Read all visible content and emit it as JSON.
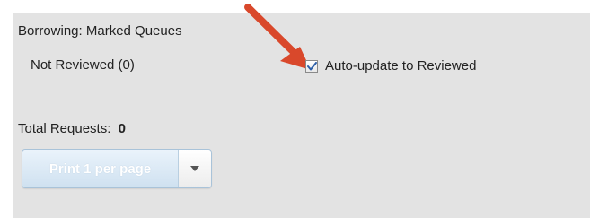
{
  "section": {
    "title": "Borrowing: Marked Queues"
  },
  "queue": {
    "label": "Not Reviewed (0)"
  },
  "auto_update": {
    "label": "Auto-update to Reviewed",
    "checked": true
  },
  "totals": {
    "label": "Total Requests:",
    "count": "0"
  },
  "print_button": {
    "label": "Print 1 per page",
    "dropdown_icon": "caret-down-icon"
  },
  "colors": {
    "panel_bg": "#e3e3e3",
    "arrow": "#d9482b",
    "checkmark": "#2d5fa8",
    "button_text": "#ffffff"
  }
}
